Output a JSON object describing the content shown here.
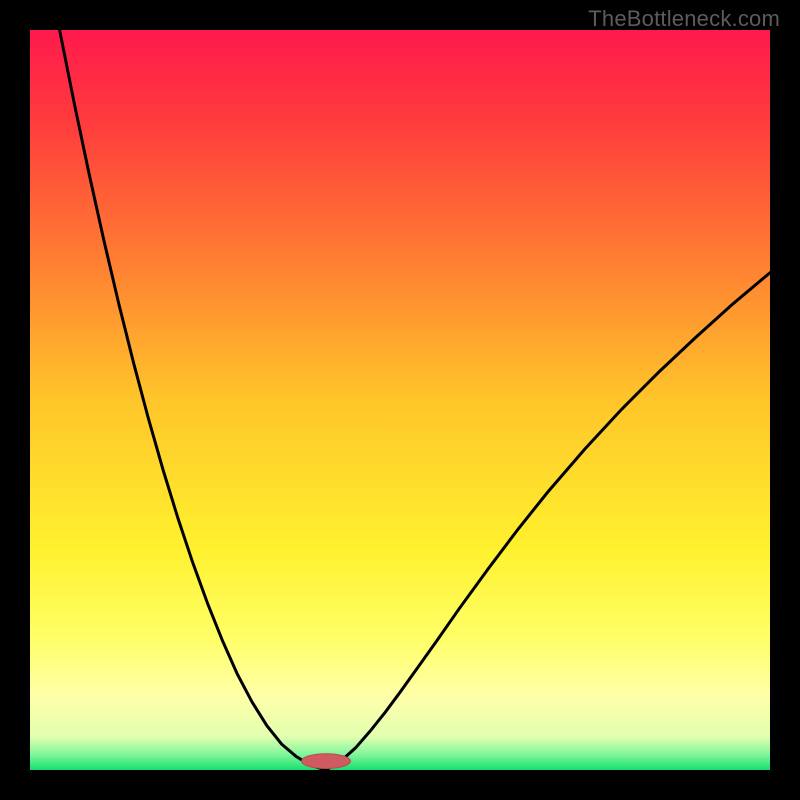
{
  "watermark": "TheBottleneck.com",
  "colors": {
    "frame": "#000000",
    "curve": "#000000",
    "marker_fill": "#cf5b61",
    "marker_stroke": "#b54b50",
    "gradient_stops": [
      {
        "offset": 0.0,
        "color": "#ff1a4d"
      },
      {
        "offset": 0.12,
        "color": "#ff3a3d"
      },
      {
        "offset": 0.3,
        "color": "#ff7a33"
      },
      {
        "offset": 0.5,
        "color": "#ffc52a"
      },
      {
        "offset": 0.7,
        "color": "#fff12e"
      },
      {
        "offset": 0.82,
        "color": "#ffff66"
      },
      {
        "offset": 0.9,
        "color": "#ffffa8"
      },
      {
        "offset": 0.955,
        "color": "#e2ffb0"
      },
      {
        "offset": 0.98,
        "color": "#7cf59a"
      },
      {
        "offset": 1.0,
        "color": "#16e06e"
      }
    ]
  },
  "chart_data": {
    "type": "line",
    "title": "",
    "xlabel": "",
    "ylabel": "",
    "xlim": [
      0,
      100
    ],
    "ylim": [
      0,
      100
    ],
    "grid": false,
    "min_x": 40,
    "marker": {
      "x": 40,
      "y": 1.2,
      "rx": 3.3,
      "ry": 1.0
    },
    "left_curve_x": [
      4,
      6,
      8,
      10,
      12,
      14,
      16,
      18,
      20,
      22,
      24,
      26,
      28,
      30,
      32,
      34,
      36,
      38,
      40
    ],
    "left_curve_y": [
      100,
      90,
      80.5,
      71.5,
      63,
      55,
      47.5,
      40.5,
      34,
      28,
      22.5,
      17.5,
      13,
      9.2,
      6.0,
      3.5,
      1.8,
      0.6,
      0
    ],
    "right_curve_x": [
      40,
      42,
      44,
      46,
      48,
      50,
      52,
      55,
      58,
      62,
      66,
      70,
      75,
      80,
      85,
      90,
      95,
      100
    ],
    "right_curve_y": [
      0,
      1.2,
      3.0,
      5.3,
      7.8,
      10.5,
      13.3,
      17.5,
      21.8,
      27.3,
      32.6,
      37.6,
      43.4,
      48.8,
      53.8,
      58.5,
      63.0,
      67.2
    ]
  }
}
